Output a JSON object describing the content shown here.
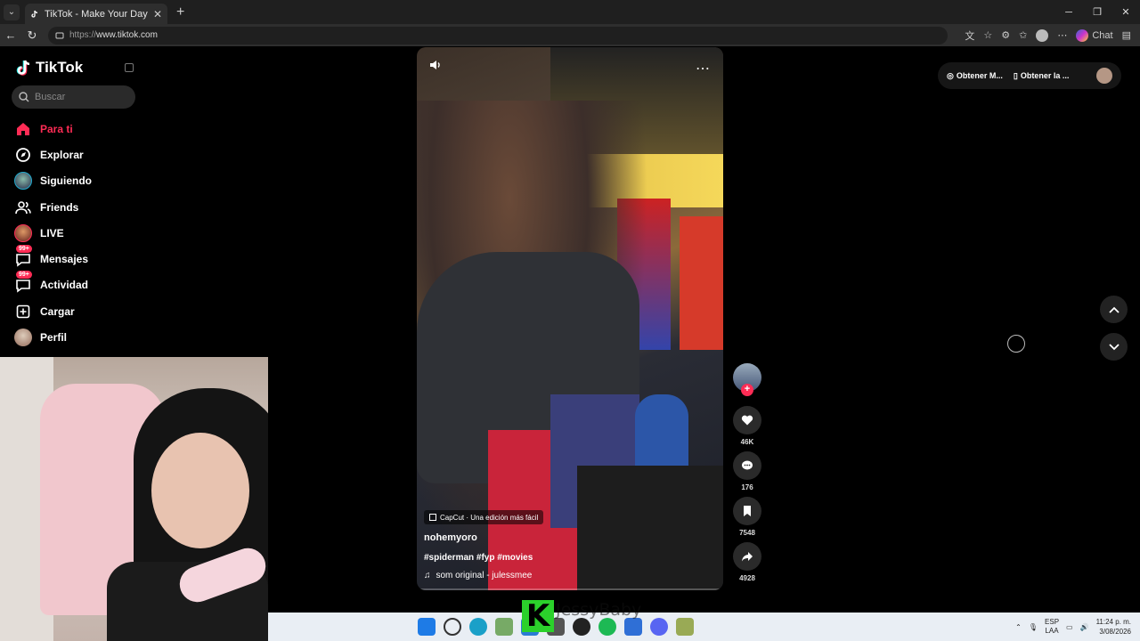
{
  "browser": {
    "tab_title": "TikTok - Make Your Day",
    "new_tab": "+",
    "url_protocol": "https://",
    "url_host": "www.tiktok.com",
    "chat_label": "Chat"
  },
  "sidebar": {
    "logo": "TikTok",
    "search_placeholder": "Buscar",
    "items": [
      {
        "label": "Para ti",
        "icon": "home-icon"
      },
      {
        "label": "Explorar",
        "icon": "compass-icon"
      },
      {
        "label": "Siguiendo",
        "icon": "following-avatar"
      },
      {
        "label": "Friends",
        "icon": "friends-icon"
      },
      {
        "label": "LIVE",
        "icon": "live-avatar"
      },
      {
        "label": "Mensajes",
        "icon": "messages-icon",
        "badge": "99+"
      },
      {
        "label": "Actividad",
        "icon": "activity-icon",
        "badge": "99+"
      },
      {
        "label": "Cargar",
        "icon": "upload-icon"
      },
      {
        "label": "Perfil",
        "icon": "profile-avatar"
      }
    ]
  },
  "video": {
    "capcut_label": "CapCut · Una edición más fácil",
    "author": "nohemyoro",
    "tags": "#spiderman #fyp #movies",
    "music": "som original - julessmee",
    "progress": 0.0
  },
  "actions": {
    "likes": "46K",
    "comments": "176",
    "saves": "7548",
    "shares": "4928"
  },
  "topright": {
    "get_coins": "Obtener M...",
    "get_app": "Obtener la ..."
  },
  "overlay": {
    "brand_letter": "K",
    "brand_name": "JessyBaby"
  },
  "taskbar": {
    "lang_top": "ESP",
    "lang_bottom": "LAA",
    "time": "11:24 p. m.",
    "date": "3/08/2026"
  },
  "colors": {
    "accent": "#fe2c55",
    "taskbar": "#e9eef4",
    "brand_green": "#2bd12b"
  }
}
